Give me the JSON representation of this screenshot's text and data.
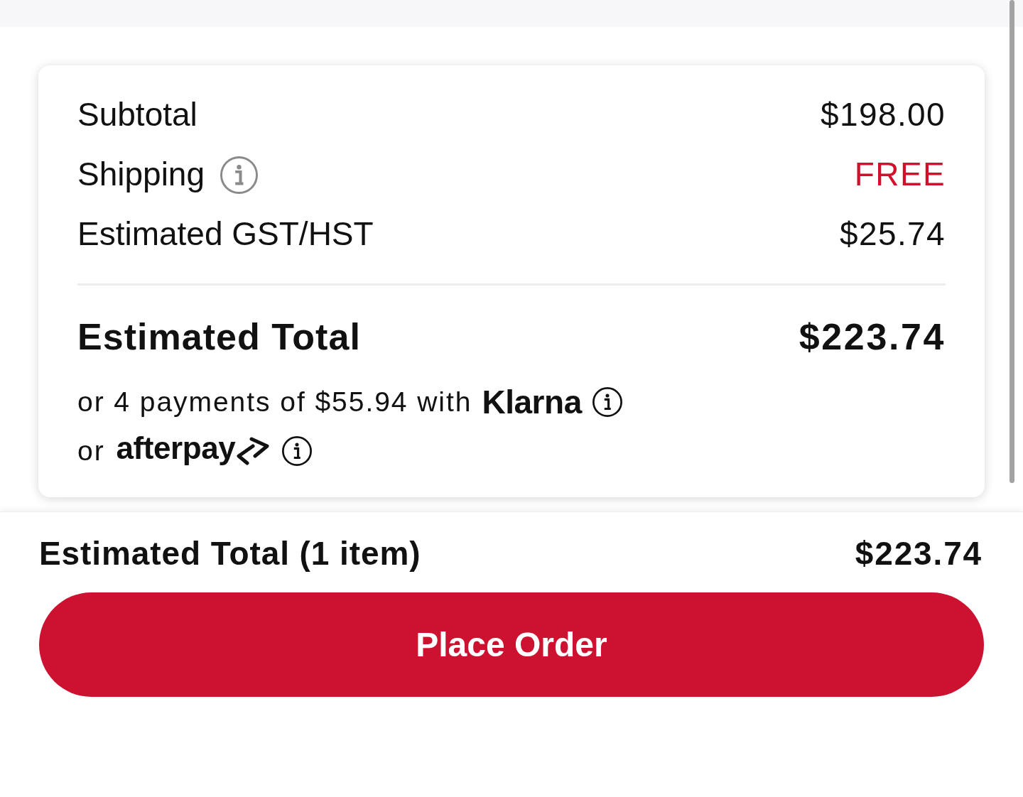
{
  "summary": {
    "rows": [
      {
        "label": "Subtotal",
        "value": "$198.00",
        "has_info": false,
        "highlighted": false
      },
      {
        "label": "Shipping",
        "value": "FREE",
        "has_info": true,
        "highlighted": true
      },
      {
        "label": "Estimated GST/HST",
        "value": "$25.74",
        "has_info": false,
        "highlighted": false
      }
    ],
    "total": {
      "label": "Estimated Total",
      "value": "$223.74"
    },
    "installments": [
      {
        "kind": "klarna",
        "text": "or 4 payments of $55.94 with",
        "brand": "Klarna"
      },
      {
        "kind": "afterpay",
        "text": "or",
        "brand": "afterpay"
      }
    ]
  },
  "footer": {
    "label": "Estimated Total (1 item)",
    "value": "$223.74",
    "button": "Place Order"
  }
}
